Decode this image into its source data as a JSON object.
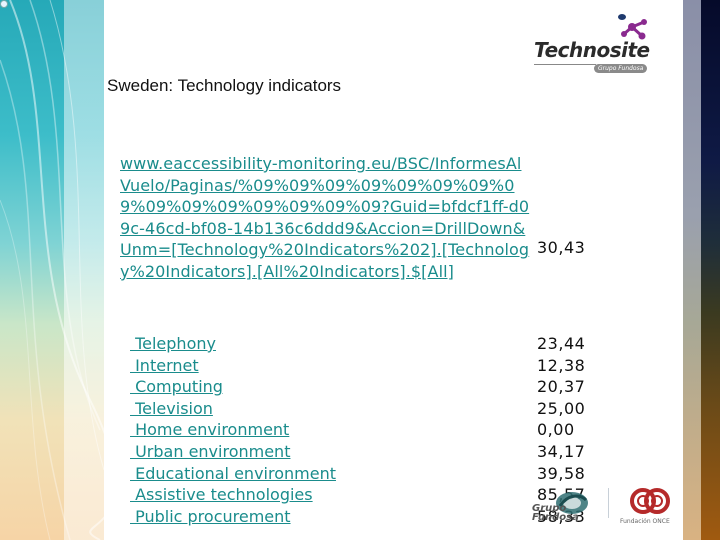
{
  "slide": {
    "title": "Sweden: Technology indicators",
    "logo_top": {
      "brand": "Technosite",
      "sub": "Grupo Fundosa"
    },
    "link": {
      "text": " www.eaccessibility-monitoring.eu/BSC/InformesAlVuelo/Paginas/%09%09%09%09%09%09%09%09%09%09%09%09%09%09%09?Guid=bfdcf1ff-d09c-46cd-bf08-14b136c6ddd9&Accion=DrillDown&Unm=[Technology%20Indicators%202].[Technology%20Indicators].[All%20Indicators].$[All]",
      "value": "30,43"
    },
    "indicators": [
      {
        "label": " Telephony",
        "value": "23,44"
      },
      {
        "label": " Internet",
        "value": "12,38"
      },
      {
        "label": " Computing",
        "value": "20,37"
      },
      {
        "label": " Television",
        "value": "25,00"
      },
      {
        "label": " Home environment",
        "value": "0,00"
      },
      {
        "label": " Urban environment",
        "value": "34,17"
      },
      {
        "label": " Educational environment",
        "value": "39,58"
      },
      {
        "label": " Assistive technologies",
        "value": "85,57"
      },
      {
        "label": " Public procurement",
        "value": "58,33"
      }
    ],
    "footer_logos": {
      "fundosa": "Grupo Fundosa",
      "once": "Fundación ONCE"
    },
    "colors": {
      "link": "#1a8c8c",
      "text": "#111111",
      "once_red": "#b52a2a",
      "technosite_purple": "#8a2a8f"
    }
  }
}
